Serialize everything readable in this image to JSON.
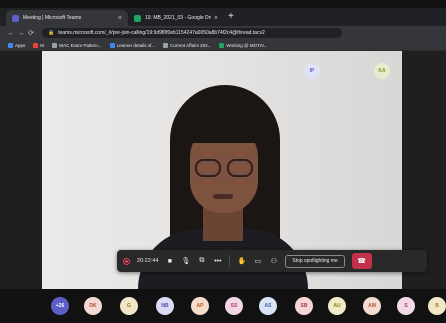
{
  "browser": {
    "tabs": [
      {
        "title": "Meeting | Microsoft Teams",
        "active": true,
        "favicon_color": "#5b5fc7"
      },
      {
        "title": "19. MB_2021_03 - Google Drive",
        "active": false,
        "favicon_color": "#1fa463"
      }
    ],
    "url": "teams.microsoft.com/_#/pre-join-calling/19:9d9f0f0eb1154247a0050a8b74f2c4@thread.tacv2",
    "bookmarks": [
      {
        "label": "Apps",
        "color": "#4285f4"
      },
      {
        "label": "M",
        "color": "#ea4335"
      },
      {
        "label": "WAC Exam Pattern...",
        "color": "#9aa0a6"
      },
      {
        "label": "Learner details of...",
        "color": "#4285f4"
      },
      {
        "label": "Current Affairs 202...",
        "color": "#9aa0a6"
      },
      {
        "label": "Working @ MOTIV...",
        "color": "#1fa463"
      }
    ]
  },
  "meeting": {
    "tile_avatars": [
      {
        "initials": "IP",
        "bg": "#dfe3f5",
        "fg": "#5b5fc7"
      },
      {
        "initials": "KA",
        "bg": "#e8eccf",
        "fg": "#8a8a2a"
      }
    ],
    "controls": {
      "timer": "20:22:44",
      "spotlight_label": "Stop spotlighting me",
      "accent": "#c4314b"
    },
    "participants": [
      {
        "initials": "+26",
        "bg": "#5b5fc7",
        "fg": "#ffffff"
      },
      {
        "initials": "DK",
        "bg": "#f3d9d2",
        "fg": "#b04a32"
      },
      {
        "initials": "G",
        "bg": "#f1e6c7",
        "fg": "#9b7a15"
      },
      {
        "initials": "NB",
        "bg": "#d9dcf4",
        "fg": "#4b4fb3"
      },
      {
        "initials": "AP",
        "bg": "#f5dccb",
        "fg": "#c05a1a"
      },
      {
        "initials": "SS",
        "bg": "#f3d6e3",
        "fg": "#b03a70"
      },
      {
        "initials": "AS",
        "bg": "#d8e3f3",
        "fg": "#3a64a8"
      },
      {
        "initials": "SB",
        "bg": "#f5d6d6",
        "fg": "#b03a3a"
      },
      {
        "initials": "AU",
        "bg": "#f1ecc7",
        "fg": "#8f7a10"
      },
      {
        "initials": "AM",
        "bg": "#f3dcd2",
        "fg": "#b05a32"
      },
      {
        "initials": "S",
        "bg": "#f3d9e6",
        "fg": "#a8386c"
      },
      {
        "initials": "B",
        "bg": "#f1e8c7",
        "fg": "#9b7a15"
      }
    ]
  }
}
